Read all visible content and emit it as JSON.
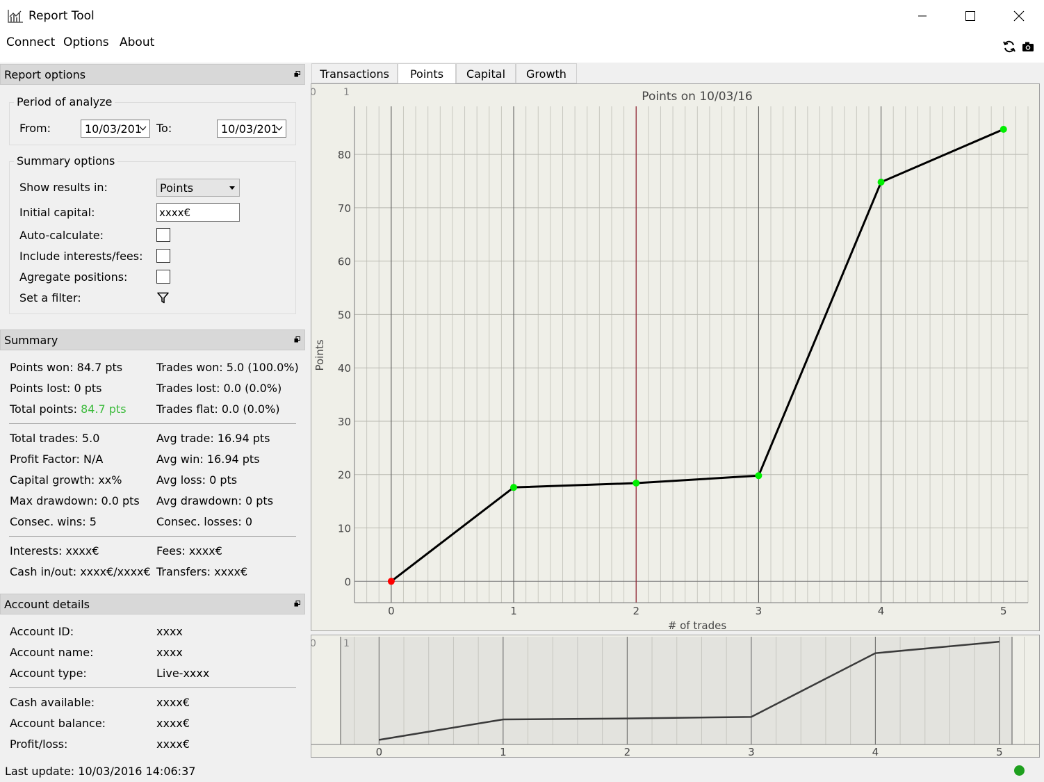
{
  "window": {
    "title": "Report Tool"
  },
  "menu": {
    "items": [
      "Connect",
      "Options",
      "About"
    ]
  },
  "toolbar": {
    "refresh_icon": "refresh-icon",
    "camera_icon": "camera-icon"
  },
  "report_options": {
    "title": "Report options",
    "period": {
      "title": "Period of analyze",
      "from_label": "From:",
      "from_value": "10/03/201",
      "to_label": "To:",
      "to_value": "10/03/201"
    },
    "summary_options": {
      "title": "Summary options",
      "show_results_label": "Show results in:",
      "show_results_value": "Points",
      "initial_capital_label": "Initial capital:",
      "initial_capital_value": "xxxx€",
      "auto_calc_label": "Auto-calculate:",
      "include_fees_label": "Include interests/fees:",
      "aggregate_label": "Agregate positions:",
      "filter_label": "Set a filter:"
    }
  },
  "summary": {
    "title": "Summary",
    "points_won": "Points won: 84.7 pts",
    "points_lost": "Points lost: 0 pts",
    "total_points_label": "Total points: ",
    "total_points_value": "84.7 pts",
    "trades_won": "Trades won: 5.0 (100.0%)",
    "trades_lost": "Trades lost: 0.0 (0.0%)",
    "trades_flat": "Trades flat: 0.0 (0.0%)",
    "total_trades": "Total trades: 5.0",
    "profit_factor": "Profit Factor: N/A",
    "capital_growth": "Capital growth: xx%",
    "max_drawdown": "Max drawdown: 0.0 pts",
    "consec_wins": "Consec. wins: 5",
    "avg_trade": "Avg trade: 16.94 pts",
    "avg_win": "Avg win: 16.94 pts",
    "avg_loss": "Avg loss: 0 pts",
    "avg_drawdown": "Avg drawdown: 0 pts",
    "consec_losses": "Consec. losses: 0",
    "interests": "Interests: xxxx€",
    "cash_inout": "Cash in/out: xxxx€/xxxx€",
    "fees": "Fees: xxxx€",
    "transfers": "Transfers: xxxx€",
    "accent_color": "#3cbb3c"
  },
  "account": {
    "title": "Account details",
    "id_label": "Account ID:",
    "id_value": "xxxx",
    "name_label": "Account name:",
    "name_value": "xxxx",
    "type_label": "Account type:",
    "type_value": "Live-xxxx",
    "cash_label": "Cash available:",
    "cash_value": "xxxx€",
    "balance_label": "Account balance:",
    "balance_value": "xxxx€",
    "pl_label": "Profit/loss:",
    "pl_value": "xxxx€"
  },
  "tabs": [
    "Transactions",
    "Points",
    "Capital",
    "Growth"
  ],
  "active_tab": "Points",
  "status": {
    "last_update": "Last update: 10/03/2016 14:06:37",
    "connection_color": "#1ea01e"
  },
  "chart_data": [
    {
      "type": "line",
      "title": "Points on 10/03/16",
      "xlabel": "# of trades",
      "ylabel": "Points",
      "x": [
        0,
        1,
        2,
        3,
        4,
        5
      ],
      "values": [
        0,
        17.6,
        18.4,
        19.8,
        74.8,
        84.7
      ],
      "point_colors": [
        "#ff0000",
        "#00ee00",
        "#00ee00",
        "#00ee00",
        "#00ee00",
        "#00ee00"
      ],
      "xlim": [
        -0.3,
        5.2
      ],
      "ylim": [
        -4,
        89
      ],
      "xticks": [
        0,
        1,
        2,
        3,
        4,
        5
      ],
      "yticks": [
        0,
        10,
        20,
        30,
        40,
        50,
        60,
        70,
        80
      ],
      "cursor_x": 2,
      "cursor_color": "#8b1a2a",
      "corner_labels": [
        "0",
        "1"
      ],
      "grid": true
    },
    {
      "type": "line",
      "title": "",
      "x": [
        0,
        1,
        2,
        3,
        4,
        5
      ],
      "values": [
        0,
        17.6,
        18.4,
        19.8,
        74.8,
        84.7
      ],
      "xlim": [
        -0.31,
        5.32
      ],
      "ylim": [
        -4,
        89
      ],
      "xticks": [
        0,
        1,
        2,
        3,
        4,
        5
      ],
      "corner_labels": [
        "0",
        "1"
      ],
      "grid": true
    }
  ]
}
